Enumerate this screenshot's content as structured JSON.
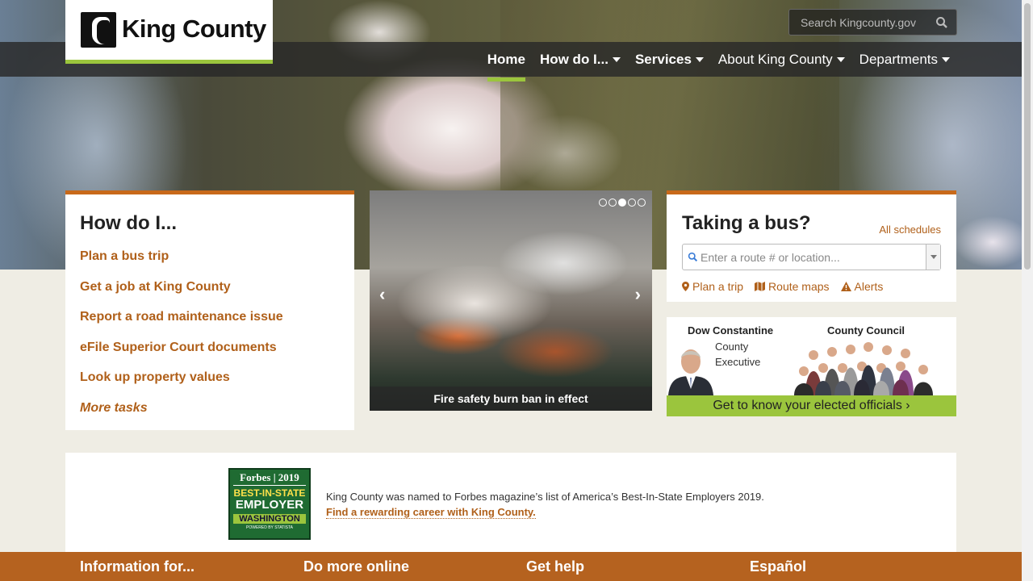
{
  "header": {
    "logo_text": "King County",
    "search_placeholder": "Search Kingcounty.gov",
    "nav": [
      {
        "label": "Home"
      },
      {
        "label": "How do I..."
      },
      {
        "label": "Services"
      },
      {
        "label": "About King County"
      },
      {
        "label": "Departments"
      }
    ]
  },
  "howdo": {
    "title": "How do I...",
    "items": [
      "Plan a bus trip",
      "Get a job at King County",
      "Report a road maintenance issue",
      "eFile Superior Court documents",
      "Look up property values"
    ],
    "more": "More tasks"
  },
  "carousel": {
    "caption": "Fire safety burn ban in effect",
    "active_slide": 3,
    "slide_count": 5
  },
  "bus": {
    "title": "Taking a bus?",
    "all_schedules": "All schedules",
    "route_placeholder": "Enter a route # or location...",
    "links": [
      "Plan a trip",
      "Route maps",
      "Alerts"
    ]
  },
  "officials": {
    "exec_name": "Dow Constantine",
    "exec_title": "County Executive",
    "council_name": "County Council",
    "banner": "Get to know your elected officials ›"
  },
  "forbes": {
    "badge_line1": "Forbes | 2019",
    "badge_line2": "BEST-IN-STATE",
    "badge_line3": "EMPLOYER",
    "badge_line4": "WASHINGTON",
    "badge_line5": "POWERED BY STATISTA",
    "text": "King County was named to Forbes magazine’s list of America’s Best-In-State Employers 2019.",
    "link": "Find a rewarding career with King County."
  },
  "footer": [
    "Information for...",
    "Do more online",
    "Get help",
    "Español"
  ],
  "colors": {
    "accent_orange": "#c8691a",
    "accent_green": "#9bc53d",
    "link": "#b0601a",
    "footer": "#b5621f"
  }
}
